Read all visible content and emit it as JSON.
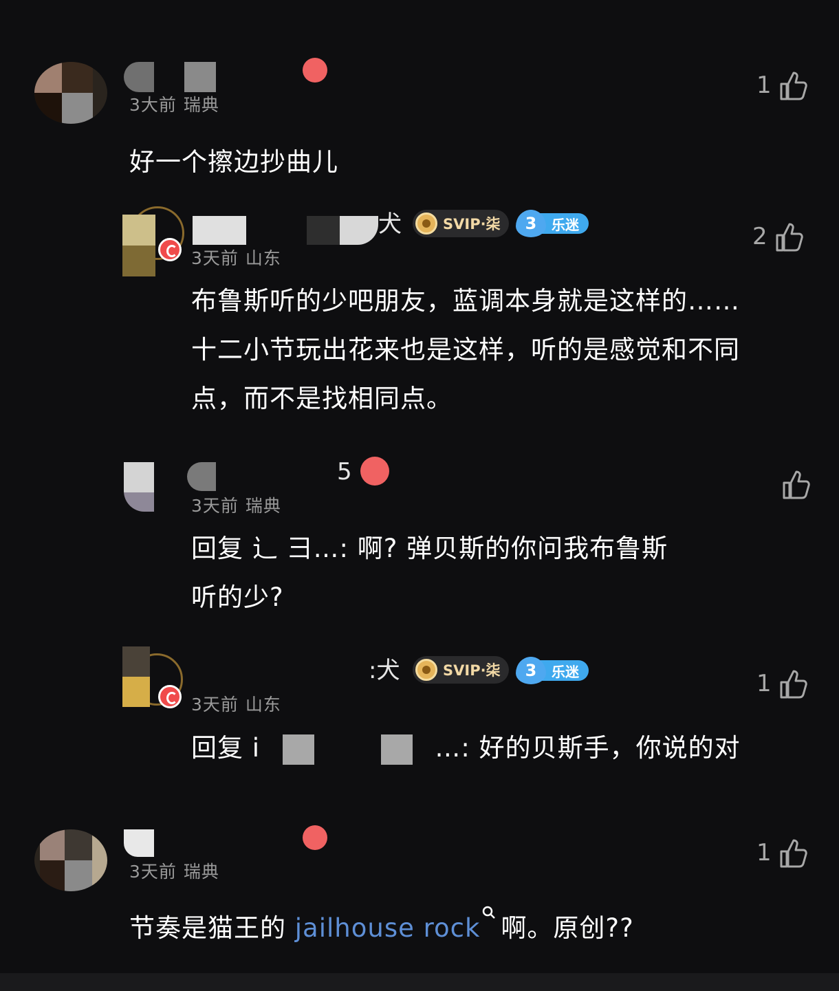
{
  "comments": [
    {
      "name_tail": "",
      "time": "3大前",
      "location": "瑞典",
      "likes": "1",
      "text_lines": [
        "好一个擦边抄曲儿"
      ]
    },
    {
      "name_tail": "犬",
      "time": "3天前",
      "location": "山东",
      "likes": "2",
      "svip": "SVIP·柒",
      "fan_level": "3",
      "fan_label": "乐迷",
      "text_lines": [
        "布鲁斯听的少吧朋友，蓝调本身就是这样的……",
        "十二小节玩出花来也是这样，听的是感觉和不同",
        "点，而不是找相同点。"
      ]
    },
    {
      "name_tail": "5",
      "time": "3天前",
      "location": "瑞典",
      "likes": "",
      "text_lines": [
        "回复 辶            彐…: 啊? 弹贝斯的你问我布鲁斯",
        "听的少?"
      ]
    },
    {
      "name_tail": ":犬",
      "time": "3天前",
      "location": "山东",
      "likes": "1",
      "svip": "SVIP·柒",
      "fan_level": "3",
      "fan_label": "乐迷",
      "reply_prefix": "回复 i",
      "reply_suffix": "…: 好的贝斯手，你说的对"
    },
    {
      "name_tail": "",
      "time": "3天前",
      "location": "瑞典",
      "likes": "1",
      "text_before_link": "节奏是猫王的",
      "link_text": "jailhouse rock",
      "text_after_link": "啊。原创??"
    }
  ]
}
